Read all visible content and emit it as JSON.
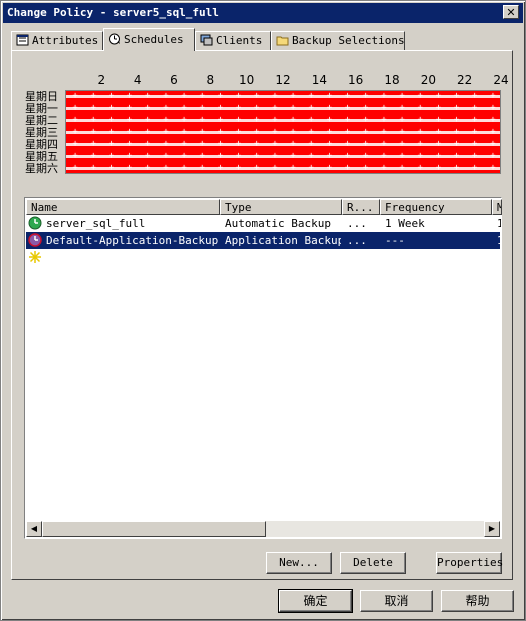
{
  "window": {
    "title": "Change Policy - server5_sql_full",
    "close_glyph": "✕"
  },
  "tabs": [
    {
      "label": "Attributes",
      "icon": "attributes-icon",
      "active": false
    },
    {
      "label": "Schedules",
      "icon": "schedules-icon",
      "active": true
    },
    {
      "label": "Clients",
      "icon": "clients-icon",
      "active": false
    },
    {
      "label": "Backup Selections",
      "icon": "folder-icon",
      "active": false
    }
  ],
  "calendar": {
    "hours": [
      "2",
      "4",
      "6",
      "8",
      "10",
      "12",
      "14",
      "16",
      "18",
      "20",
      "22",
      "24"
    ],
    "days": [
      "星期日",
      "星期一",
      "星期二",
      "星期三",
      "星期四",
      "星期五",
      "星期六"
    ],
    "window_color": "#ff0000",
    "mark_glyph": "+"
  },
  "schedules": {
    "columns": [
      "Name",
      "Type",
      "R...",
      "Frequency",
      "M"
    ],
    "rows": [
      {
        "name": "server_sql_full",
        "type": "Automatic Backup",
        "r": "...",
        "frequency": "1 Week",
        "m": "1",
        "icon": "clock-icon",
        "selected": false
      },
      {
        "name": "Default-Application-Backup",
        "type": "Application Backup",
        "r": "...",
        "frequency": "---",
        "m": "1",
        "icon": "clock-icon",
        "selected": true
      }
    ],
    "new_row_icon": "new-item-icon"
  },
  "buttons": {
    "new": "New...",
    "delete": "Delete",
    "properties": "Properties",
    "ok": "确定",
    "cancel": "取消",
    "help": "帮助"
  },
  "colors": {
    "titlebar": "#0a246a",
    "selection": "#0a246a",
    "face": "#d4d0c8"
  }
}
